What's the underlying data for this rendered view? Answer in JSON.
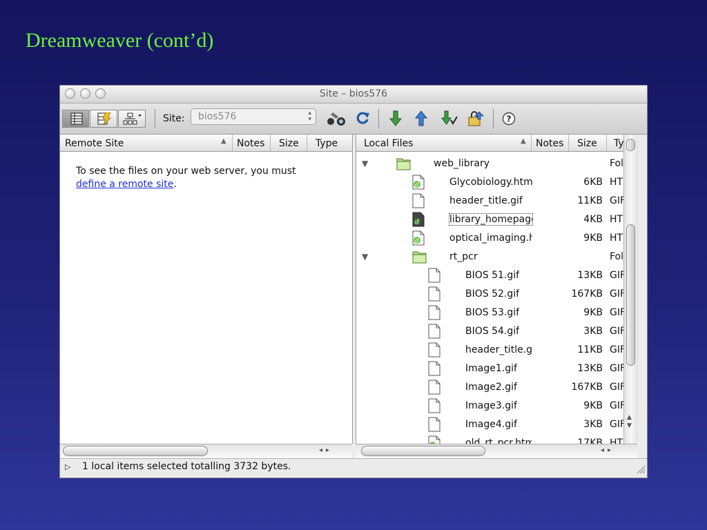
{
  "slide": {
    "title": "Dreamweaver (cont’d)"
  },
  "window": {
    "title": "Site – bios576"
  },
  "toolbar": {
    "site_label": "Site:",
    "site_value": "bios576"
  },
  "remote": {
    "headers": [
      "Remote Site",
      "Notes",
      "Size",
      "Type"
    ],
    "message_prefix": "To see the files on your web server, you must",
    "message_link": "define a remote site",
    "message_suffix": "."
  },
  "local": {
    "headers": [
      "Local Files",
      "Notes",
      "Size",
      "Type"
    ],
    "files": [
      {
        "name": "web_library",
        "size": "",
        "type": "Folder",
        "kind": "folder",
        "level": 0,
        "expanded": true
      },
      {
        "name": "Glycobiology.htm",
        "size": "6KB",
        "type": "HTML",
        "kind": "html",
        "level": 1
      },
      {
        "name": "header_title.gif",
        "size": "11KB",
        "type": "GIF",
        "kind": "file",
        "level": 1
      },
      {
        "name": "library_homepage.htm",
        "size": "4KB",
        "type": "HTML",
        "kind": "html-dark",
        "level": 1,
        "selected": true
      },
      {
        "name": "optical_imaging.htm",
        "size": "9KB",
        "type": "HTML",
        "kind": "html",
        "level": 1
      },
      {
        "name": "rt_pcr",
        "size": "",
        "type": "Folder",
        "kind": "folder",
        "level": 1,
        "expanded": true
      },
      {
        "name": "BIOS 51.gif",
        "size": "13KB",
        "type": "GIF",
        "kind": "file",
        "level": 2
      },
      {
        "name": "BIOS 52.gif",
        "size": "167KB",
        "type": "GIF",
        "kind": "file",
        "level": 2
      },
      {
        "name": "BIOS 53.gif",
        "size": "9KB",
        "type": "GIF",
        "kind": "file",
        "level": 2
      },
      {
        "name": "BIOS 54.gif",
        "size": "3KB",
        "type": "GIF",
        "kind": "file",
        "level": 2
      },
      {
        "name": "header_title.gif",
        "size": "11KB",
        "type": "GIF",
        "kind": "file",
        "level": 2
      },
      {
        "name": "Image1.gif",
        "size": "13KB",
        "type": "GIF",
        "kind": "file",
        "level": 2
      },
      {
        "name": "Image2.gif",
        "size": "167KB",
        "type": "GIF",
        "kind": "file",
        "level": 2
      },
      {
        "name": "Image3.gif",
        "size": "9KB",
        "type": "GIF",
        "kind": "file",
        "level": 2
      },
      {
        "name": "Image4.gif",
        "size": "3KB",
        "type": "GIF",
        "kind": "file",
        "level": 2
      },
      {
        "name": "old_rt_pcr.htm",
        "size": "17KB",
        "type": "HTML",
        "kind": "html",
        "level": 2
      }
    ]
  },
  "status": {
    "text": "1 local items selected totalling 3732 bytes."
  },
  "colors": {
    "title_green": "#6cf33c",
    "link_blue": "#1a2edc"
  }
}
